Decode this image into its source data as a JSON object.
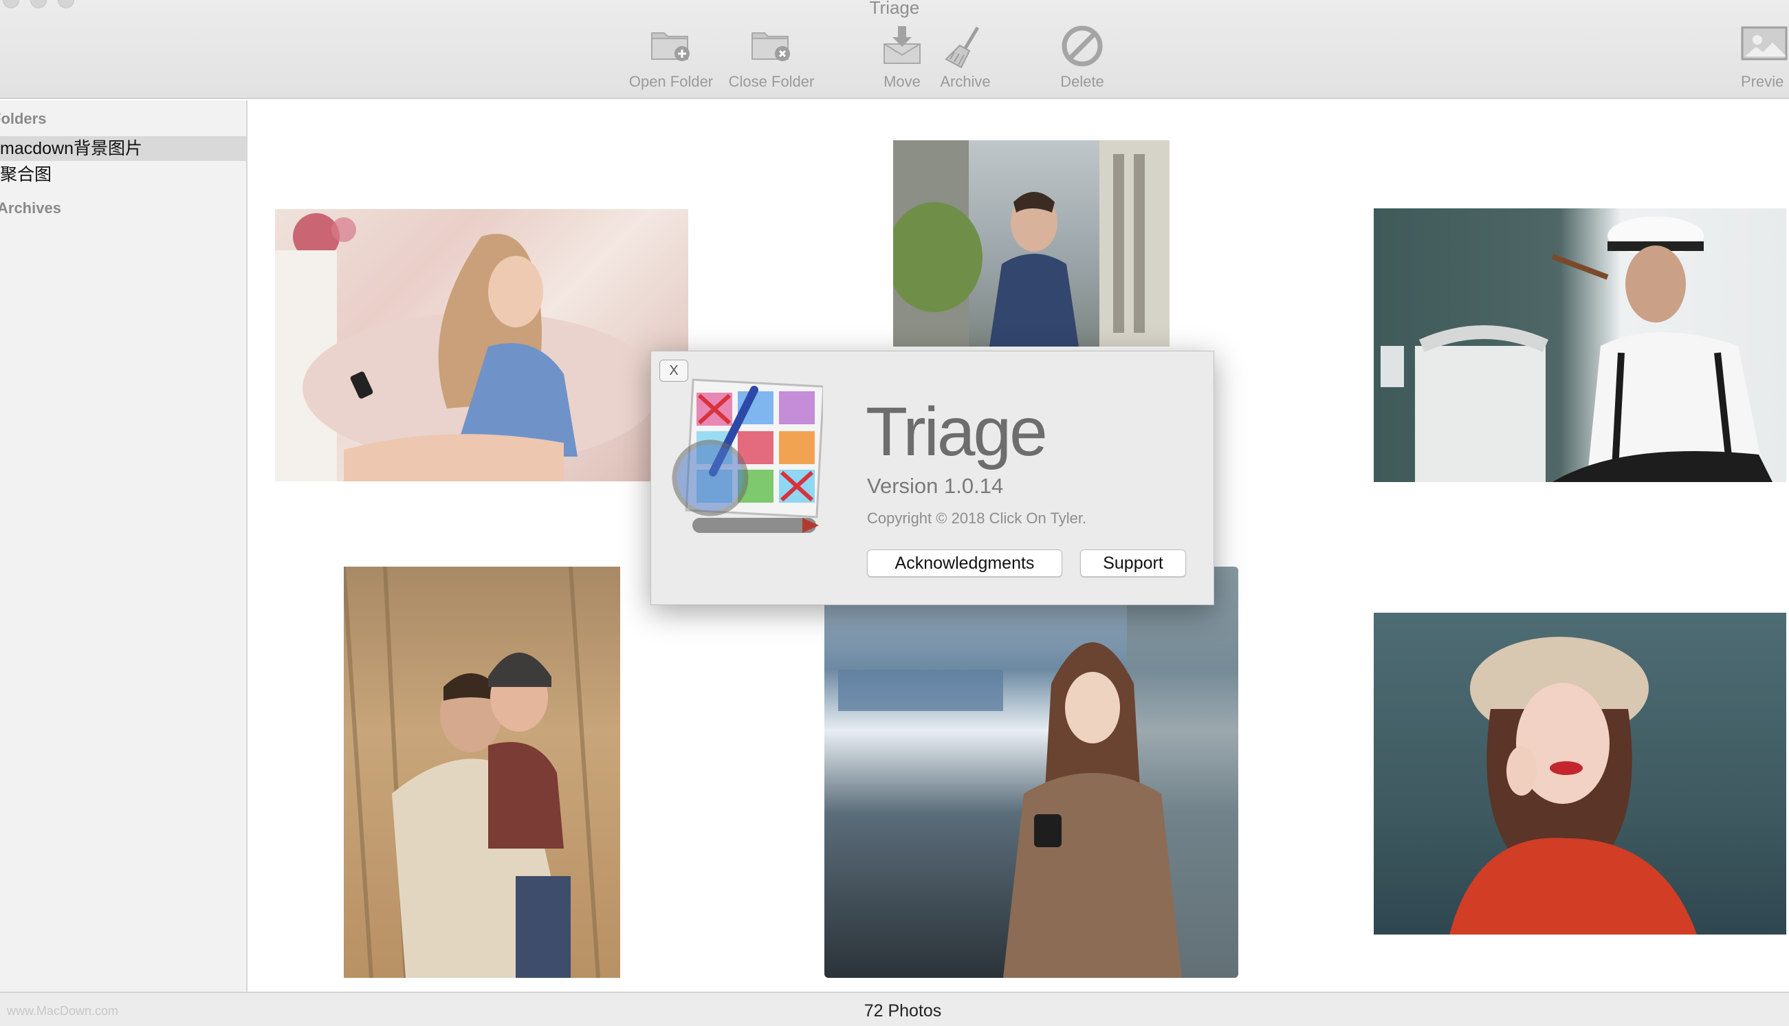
{
  "window": {
    "title": "Triage"
  },
  "toolbar": {
    "open_folder": "Open Folder",
    "close_folder": "Close Folder",
    "move": "Move",
    "archive": "Archive",
    "delete": "Delete",
    "preview": "Previe"
  },
  "sidebar": {
    "folders_header": "Folders",
    "items": [
      {
        "label": "macdown背景图片",
        "selected": true
      },
      {
        "label": "聚合图",
        "selected": false
      }
    ],
    "archives_header": "Archives"
  },
  "about": {
    "close_label": "X",
    "app_name": "Triage",
    "version": "Version 1.0.14",
    "copyright": "Copyright © 2018 Click On Tyler.",
    "acknowledgments_label": "Acknowledgments",
    "support_label": "Support"
  },
  "status": {
    "photo_count": "72 Photos",
    "watermark": "www.MacDown.com"
  },
  "icons": [
    "open-folder-icon",
    "close-folder-icon",
    "move-icon",
    "archive-icon",
    "delete-icon",
    "preview-icon",
    "triage-app-icon"
  ]
}
